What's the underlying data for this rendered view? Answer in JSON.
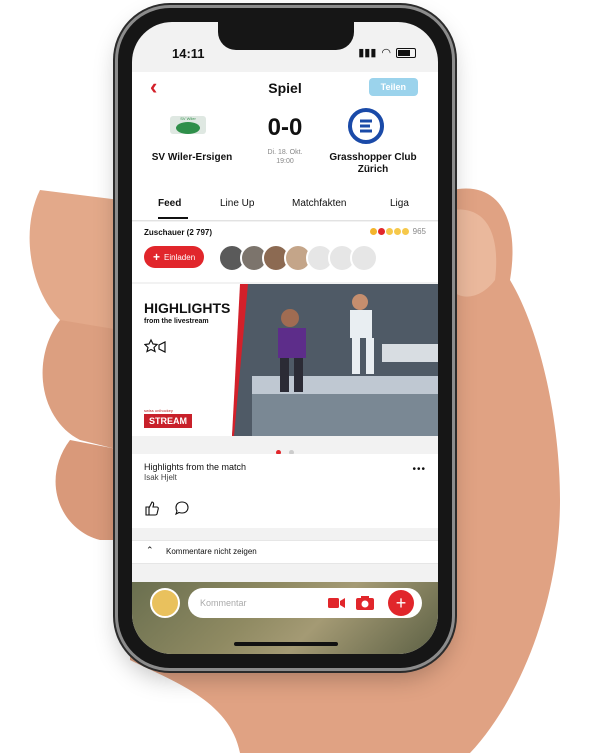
{
  "status_bar": {
    "time": "14:11"
  },
  "nav": {
    "title": "Spiel",
    "share_label": "Teilen"
  },
  "match": {
    "home_team": "SV Wiler-Ersigen",
    "score": "0-0",
    "date_line1": "Di. 18. Okt.",
    "date_line2": "19:00",
    "away_team": "Grasshopper Club Zürich"
  },
  "tabs": [
    "Feed",
    "Line Up",
    "Matchfakten",
    "Liga"
  ],
  "viewers": {
    "label": "Zuschauer (2 797)",
    "reaction_count": "965",
    "invite_label": "Einladen"
  },
  "highlight": {
    "title": "HIGHLIGHTS",
    "subtitle": "from the livestream",
    "stream_small": "swiss unihockey",
    "stream_label": "STREAM"
  },
  "post": {
    "title": "Highlights from the match",
    "author": "Isak Hjelt",
    "more": "•••"
  },
  "comments_toggle": {
    "label": "Kommentare nicht zeigen"
  },
  "comment_bar": {
    "placeholder": "Kommentar"
  },
  "colors": {
    "accent": "#e1262b",
    "share": "#9bd3ec",
    "away_logo": "#1a4aa8"
  },
  "icons": [
    "back-chevron-icon",
    "signal-icon",
    "wifi-icon",
    "battery-icon",
    "plus-icon",
    "video-star-icon",
    "like-icon",
    "comment-icon",
    "chevron-up-icon",
    "video-icon",
    "camera-icon"
  ]
}
